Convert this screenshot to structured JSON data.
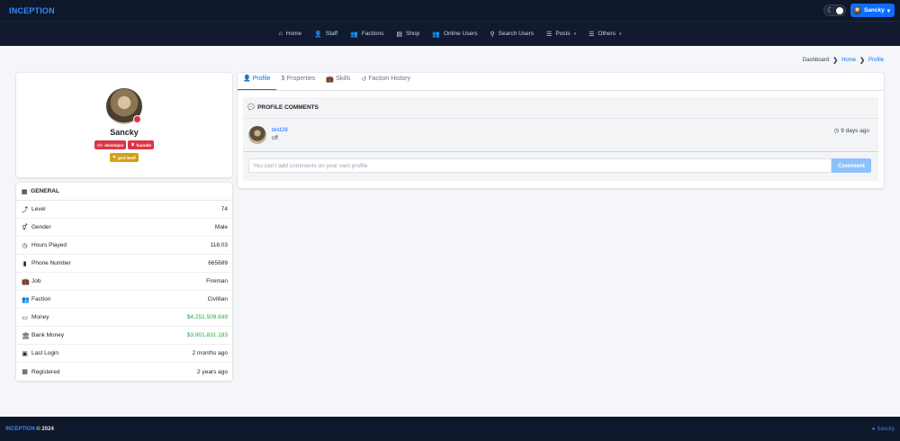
{
  "app": {
    "brand": "INCEPTION"
  },
  "header": {
    "theme_icon": "moon-icon",
    "user_name": "Sancky",
    "user_caret": "▾"
  },
  "nav": {
    "items": [
      {
        "icon": "home-icon",
        "glyph": "⌂",
        "label": "Home"
      },
      {
        "icon": "staff-icon",
        "glyph": "👤",
        "label": "Staff"
      },
      {
        "icon": "factions-icon",
        "glyph": "👥",
        "label": "Factions"
      },
      {
        "icon": "shop-icon",
        "glyph": "▤",
        "label": "Shop"
      },
      {
        "icon": "online-users-icon",
        "glyph": "👥",
        "label": "Online Users"
      },
      {
        "icon": "search-icon",
        "glyph": "⚲",
        "label": "Search Users"
      },
      {
        "icon": "list-icon",
        "glyph": "☰",
        "label": "Posts"
      },
      {
        "icon": "list-icon",
        "glyph": "☰",
        "label": "Others"
      }
    ]
  },
  "breadcrumb": {
    "items": [
      "Dashboard",
      "Home",
      "Profile"
    ],
    "sep": "❯"
  },
  "profile": {
    "name": "Sancky",
    "badges": [
      {
        "label": "developer",
        "glyph": "</>",
        "color": "#dc3545"
      },
      {
        "label": "founder",
        "glyph": "♛",
        "color": "#dc3545"
      },
      {
        "label": "god itself",
        "glyph": "✎",
        "color": "#d4a017"
      }
    ]
  },
  "general": {
    "title": "GENERAL",
    "rows": [
      {
        "icon": "level-icon",
        "glyph": "⤴",
        "label": "Level",
        "value": "74"
      },
      {
        "icon": "gender-icon",
        "glyph": "⚥",
        "label": "Gender",
        "value": "Male"
      },
      {
        "icon": "clock-icon",
        "glyph": "◷",
        "label": "Hours Played",
        "value": "118.03"
      },
      {
        "icon": "phone-icon",
        "glyph": "▮",
        "label": "Phone Number",
        "value": "665689"
      },
      {
        "icon": "briefcase-icon",
        "glyph": "💼",
        "label": "Job",
        "value": "Fireman"
      },
      {
        "icon": "faction-icon",
        "glyph": "👥",
        "label": "Faction",
        "value": "Civillian"
      },
      {
        "icon": "money-icon",
        "glyph": "▭",
        "label": "Money",
        "value": "$4.251.509.849"
      },
      {
        "icon": "bank-icon",
        "glyph": "🏛",
        "label": "Bank Money",
        "value": "$3.901.831.183"
      },
      {
        "icon": "calendar-icon",
        "glyph": "▣",
        "label": "Last Login",
        "value": "2 months ago"
      },
      {
        "icon": "calendar-icon",
        "glyph": "▦",
        "label": "Registered",
        "value": "2 years ago"
      }
    ]
  },
  "tabs": [
    {
      "icon": "user-icon",
      "glyph": "👤",
      "label": "Profile",
      "active": true
    },
    {
      "icon": "dollar-icon",
      "glyph": "$",
      "label": "Properties",
      "active": false
    },
    {
      "icon": "briefcase-icon",
      "glyph": "💼",
      "label": "Skills",
      "active": false
    },
    {
      "icon": "history-icon",
      "glyph": "↺",
      "label": "Faction History",
      "active": false
    }
  ],
  "comments": {
    "title": "PROFILE COMMENTS",
    "items": [
      {
        "user": "test28",
        "text": "cff",
        "time": "9 days ago"
      }
    ],
    "input_placeholder": "You can't add comments on your own profile",
    "button_label": "Comment"
  },
  "footer": {
    "brand": "INCEPTION",
    "year": "© 2024",
    "user": "Sancky"
  },
  "colors": {
    "accent": "#0d6efd",
    "brand": "#2f8cff",
    "danger": "#dc3545",
    "warning": "#d4a017",
    "success": "#28a745",
    "topbar": "#0f172a"
  }
}
